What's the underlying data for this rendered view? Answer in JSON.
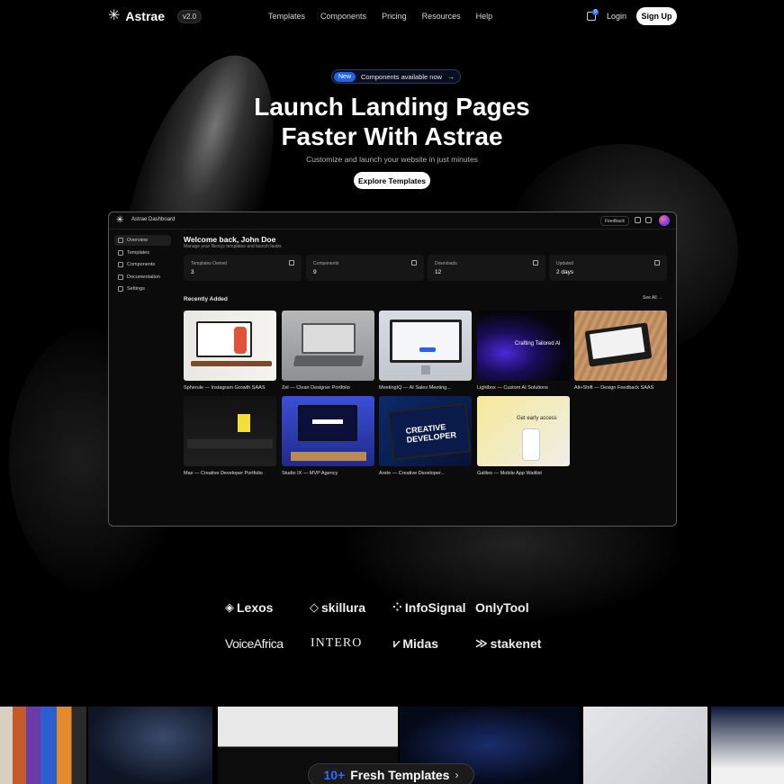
{
  "nav": {
    "logo_icon": "asterisk-logo",
    "brand": "Astrae",
    "version": "v2.0",
    "links": [
      "Templates",
      "Components",
      "Pricing",
      "Resources",
      "Help"
    ],
    "cart_count": "0",
    "login": "Login",
    "signup": "Sign Up"
  },
  "hero": {
    "badge": "New",
    "announcement": "Components available now",
    "title_line1": "Launch Landing Pages",
    "title_line2": "Faster With Astrae",
    "subtitle": "Customize and launch your website in just minutes",
    "cta": "Explore Templates"
  },
  "dashboard": {
    "title": "Astrae Dashboard",
    "feedback": "Feedback",
    "sidebar": [
      {
        "label": "Overview",
        "icon": "home-icon",
        "active": true
      },
      {
        "label": "Templates",
        "icon": "templates-icon",
        "active": false
      },
      {
        "label": "Components",
        "icon": "components-icon",
        "active": false
      },
      {
        "label": "Documentation",
        "icon": "terminal-icon",
        "active": false
      },
      {
        "label": "Settings",
        "icon": "gear-icon",
        "active": false
      }
    ],
    "welcome": "Welcome back, John Doe",
    "welcome_sub": "Manage your Next.js templates and launch faster.",
    "stats": [
      {
        "label": "Templates Owned",
        "value": "3",
        "icon": "layout-icon"
      },
      {
        "label": "Components",
        "value": "9",
        "icon": "box-icon"
      },
      {
        "label": "Downloads",
        "value": "12",
        "icon": "download-icon"
      },
      {
        "label": "Updated",
        "value": "2 days",
        "icon": "clock-icon"
      }
    ],
    "recent_title": "Recently Added",
    "see_all": "See All",
    "templates": [
      "Spherule — Instagram Growth SAAS",
      "Zel — Clean Designer Portfolio",
      "MeetingIQ — AI Sales Meeting...",
      "Lightbox — Custom AI Solutions",
      "Alt+Shift — Design Feedback SAAS",
      "Max — Creative Developer Portfolio",
      "Studio IX — MVP Agency",
      "Arete — Creative Developer...",
      "Galileo — Mobile App Waitlist"
    ],
    "thumb_texts": {
      "lightbox": "Crafting Tailored AI",
      "arete": "CREATIVE DEVELOPER",
      "galileo": "Get early access"
    }
  },
  "brands": [
    "Lexos",
    "skillura",
    "InfoSignal",
    "OnlyTool",
    "VoiceAfrica",
    "INTERO",
    "Midas",
    "stakenet"
  ],
  "bottom": {
    "count": "10+",
    "label": "Fresh Templates"
  },
  "colors": {
    "background": "#000000",
    "accent": "#2563eb",
    "card": "#161616"
  }
}
